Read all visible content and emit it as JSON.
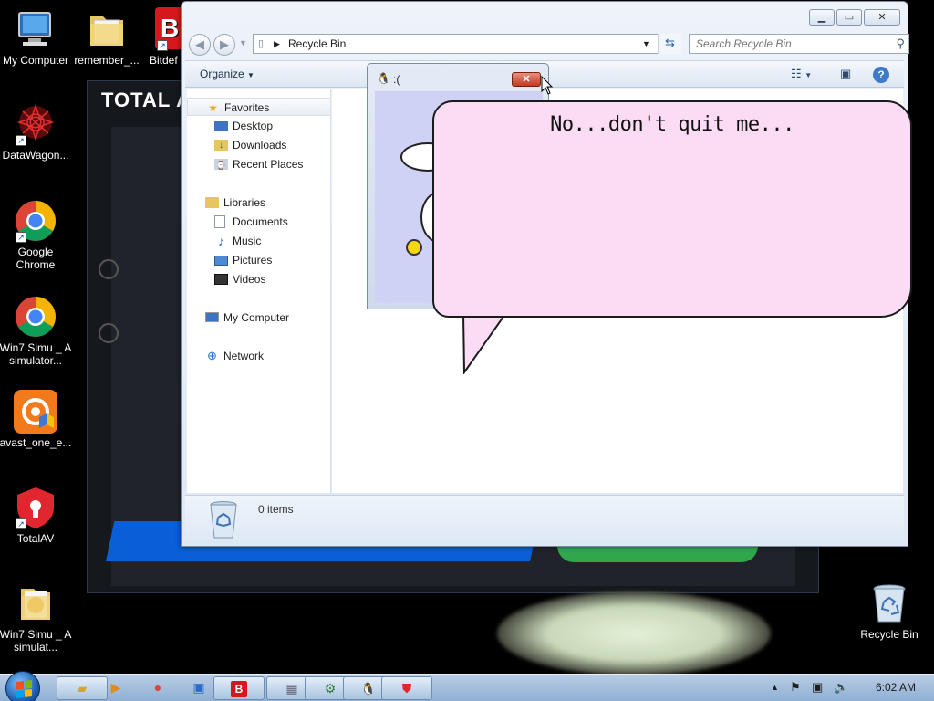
{
  "desktop": {
    "icons": [
      {
        "label": "My Computer",
        "icon": "computer-icon"
      },
      {
        "label": "remember_...",
        "icon": "folder-icon"
      },
      {
        "label": "Bitdef",
        "icon": "bitdefender-icon"
      },
      {
        "label": "DataWagon...",
        "icon": "datawagon-icon"
      },
      {
        "label": "Google Chrome",
        "icon": "chrome-icon"
      },
      {
        "label": "Win7 Simu _ A simulator...",
        "icon": "chrome-icon"
      },
      {
        "label": "avast_one_e...",
        "icon": "avast-icon"
      },
      {
        "label": "TotalAV",
        "icon": "totalav-icon"
      },
      {
        "label": "Win7 Simu _ A simulat...",
        "icon": "folder-icon"
      },
      {
        "label": "Recycle Bin",
        "icon": "recycle-bin-icon"
      }
    ]
  },
  "bg_app": {
    "title": "TOTAL A"
  },
  "explorer": {
    "address": "Recycle Bin",
    "search_placeholder": "Search Recycle Bin",
    "organize_label": "Organize",
    "nav": {
      "favorites": "Favorites",
      "desktop": "Desktop",
      "downloads": "Downloads",
      "recent_places": "Recent Places",
      "libraries": "Libraries",
      "documents": "Documents",
      "music": "Music",
      "pictures": "Pictures",
      "videos": "Videos",
      "my_computer": "My Computer",
      "network": "Network"
    },
    "details": {
      "count": "0 items"
    }
  },
  "sad_window": {
    "title": ":("
  },
  "bubble": {
    "text": "No...don't quit me..."
  },
  "taskbar": {
    "clock": "6:02 AM"
  },
  "colors": {
    "bubble": "#fcdcf4",
    "sad_body": "#cfd2f4",
    "close_red": "#c23a20",
    "yellow": "#f6d60e"
  }
}
